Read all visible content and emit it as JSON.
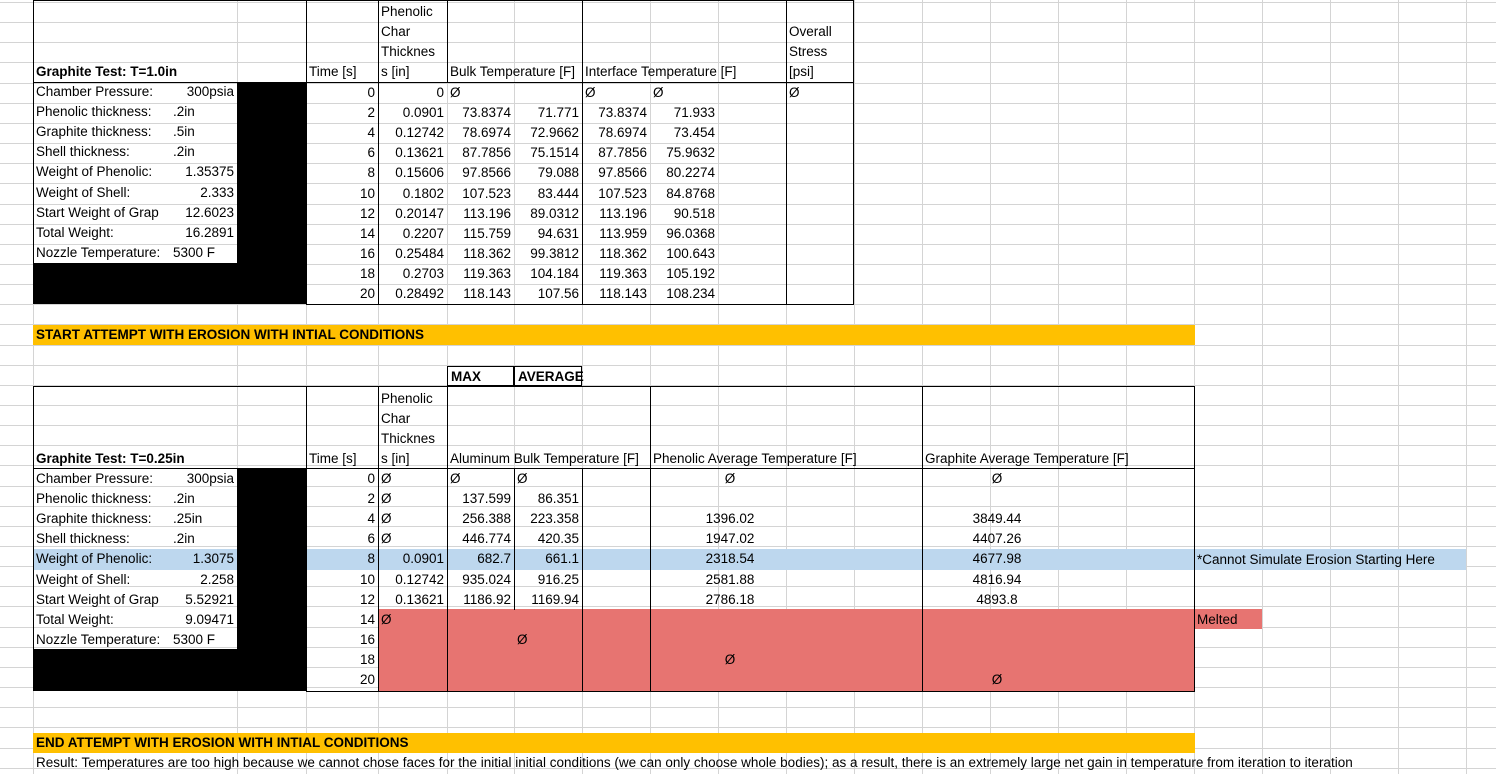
{
  "colors": {
    "gridline": "#d4d4d4",
    "header_band": "#ffc000",
    "selected_row": "#bdd7ee",
    "melted_fill": "#e77471",
    "black_block": "#000000"
  },
  "null_symbol": "Ø",
  "t1": {
    "title": "Graphite Test: T=1.0in",
    "params": [
      {
        "label": "Chamber Pressure:",
        "value": "300psia",
        "align": "right"
      },
      {
        "label": "Phenolic thickness:",
        "value": ".2in",
        "align": "left"
      },
      {
        "label": "Graphite thickness:",
        "value": ".5in",
        "align": "left"
      },
      {
        "label": "Shell thickness:",
        "value": ".2in",
        "align": "left"
      },
      {
        "label": "Weight of Phenolic:",
        "value": "1.35375",
        "align": "right"
      },
      {
        "label": "Weight of Shell:",
        "value": "2.333",
        "align": "right"
      },
      {
        "label": "Start Weight of Grap",
        "value": "12.6023",
        "align": "right"
      },
      {
        "label": "Total Weight:",
        "value": "16.2891",
        "align": "right"
      },
      {
        "label": "Nozzle Temperature:",
        "value": "5300 F",
        "align": "left"
      }
    ],
    "headers": {
      "time": "Time [s]",
      "phenolic_lines": [
        "Phenolic",
        "Char",
        "Thicknes",
        "s [in]"
      ],
      "bulk": "Bulk Temperature [F]",
      "interface": "Interface Temperature [F]",
      "stress_lines": [
        "Overall",
        "Stress",
        "[psi]"
      ]
    },
    "rows": [
      {
        "t": "0",
        "ph": "0",
        "b1": "Ø",
        "b2": "",
        "i1": "Ø",
        "i2": "Ø",
        "s": "Ø"
      },
      {
        "t": "2",
        "ph": "0.0901",
        "b1": "73.8374",
        "b2": "71.771",
        "i1": "73.8374",
        "i2": "71.933",
        "s": ""
      },
      {
        "t": "4",
        "ph": "0.12742",
        "b1": "78.6974",
        "b2": "72.9662",
        "i1": "78.6974",
        "i2": "73.454",
        "s": ""
      },
      {
        "t": "6",
        "ph": "0.13621",
        "b1": "87.7856",
        "b2": "75.1514",
        "i1": "87.7856",
        "i2": "75.9632",
        "s": ""
      },
      {
        "t": "8",
        "ph": "0.15606",
        "b1": "97.8566",
        "b2": "79.088",
        "i1": "97.8566",
        "i2": "80.2274",
        "s": ""
      },
      {
        "t": "10",
        "ph": "0.1802",
        "b1": "107.523",
        "b2": "83.444",
        "i1": "107.523",
        "i2": "84.8768",
        "s": ""
      },
      {
        "t": "12",
        "ph": "0.20147",
        "b1": "113.196",
        "b2": "89.0312",
        "i1": "113.196",
        "i2": "90.518",
        "s": ""
      },
      {
        "t": "14",
        "ph": "0.2207",
        "b1": "115.759",
        "b2": "94.631",
        "i1": "113.959",
        "i2": "96.0368",
        "s": ""
      },
      {
        "t": "16",
        "ph": "0.25484",
        "b1": "118.362",
        "b2": "99.3812",
        "i1": "118.362",
        "i2": "100.643",
        "s": ""
      },
      {
        "t": "18",
        "ph": "0.2703",
        "b1": "119.363",
        "b2": "104.184",
        "i1": "119.363",
        "i2": "105.192",
        "s": ""
      },
      {
        "t": "20",
        "ph": "0.28492",
        "b1": "118.143",
        "b2": "107.56",
        "i1": "118.143",
        "i2": "108.234",
        "s": ""
      }
    ]
  },
  "banner_start": "START ATTEMPT WITH EROSION WITH INTIAL CONDITIONS",
  "labels": {
    "max": "MAX",
    "average": "AVERAGE"
  },
  "t2": {
    "title": "Graphite Test: T=0.25in",
    "params": [
      {
        "label": "Chamber Pressure:",
        "value": "300psia",
        "align": "right"
      },
      {
        "label": "Phenolic thickness:",
        "value": ".2in",
        "align": "left"
      },
      {
        "label": "Graphite thickness:",
        "value": ".25in",
        "align": "left"
      },
      {
        "label": "Shell thickness:",
        "value": ".2in",
        "align": "left"
      },
      {
        "label": "Weight of Phenolic:",
        "value": "1.3075",
        "align": "right"
      },
      {
        "label": "Weight of Shell:",
        "value": "2.258",
        "align": "right"
      },
      {
        "label": "Start Weight of Grap",
        "value": "5.52921",
        "align": "right"
      },
      {
        "label": "Total Weight:",
        "value": "9.09471",
        "align": "right"
      },
      {
        "label": "Nozzle Temperature:",
        "value": "5300 F",
        "align": "left"
      }
    ],
    "headers": {
      "time": "Time [s]",
      "phenolic_lines": [
        "Phenolic",
        "Char",
        "Thicknes",
        "s [in]"
      ],
      "alu": "Aluminum Bulk Temperature [F]",
      "phen": "Phenolic Average Temperature [F]",
      "graph": "Graphite Average Temperature [F]"
    },
    "rows": [
      {
        "t": "0",
        "ph": "Ø",
        "a1": "Ø",
        "a2": "Ø",
        "pa": "Ø",
        "ga": "Ø"
      },
      {
        "t": "2",
        "ph": "Ø",
        "a1": "137.599",
        "a2": "86.351",
        "pa": "",
        "ga": ""
      },
      {
        "t": "4",
        "ph": "Ø",
        "a1": "256.388",
        "a2": "223.358",
        "pa": "1396.02",
        "ga": "3849.44"
      },
      {
        "t": "6",
        "ph": "Ø",
        "a1": "446.774",
        "a2": "420.35",
        "pa": "1947.02",
        "ga": "4407.26"
      },
      {
        "t": "8",
        "ph": "0.0901",
        "a1": "682.7",
        "a2": "661.1",
        "pa": "2318.54",
        "ga": "4677.98"
      },
      {
        "t": "10",
        "ph": "0.12742",
        "a1": "935.024",
        "a2": "916.25",
        "pa": "2581.88",
        "ga": "4816.94"
      },
      {
        "t": "12",
        "ph": "0.13621",
        "a1": "1186.92",
        "a2": "1169.94",
        "pa": "2786.18",
        "ga": "4893.8"
      },
      {
        "t": "14",
        "ph": "Ø",
        "a1": "",
        "a2": "",
        "pa": "",
        "ga": ""
      },
      {
        "t": "16",
        "ph": "",
        "a1": "",
        "a2": "Ø",
        "pa": "",
        "ga": ""
      },
      {
        "t": "18",
        "ph": "",
        "a1": "",
        "a2": "",
        "pa": "Ø",
        "ga": ""
      },
      {
        "t": "20",
        "ph": "",
        "a1": "",
        "a2": "",
        "pa": "",
        "ga": "Ø"
      }
    ],
    "note_row8": "*Cannot Simulate Erosion Starting Here",
    "melted_label": "Melted"
  },
  "banner_end": "END ATTEMPT WITH EROSION WITH INTIAL CONDITIONS",
  "result": "Result: Temperatures are too high because we cannot chose faces for the initial initial conditions (we can only choose whole bodies); as a result, there is an extremely large net gain in temperature from iteration to iteration"
}
